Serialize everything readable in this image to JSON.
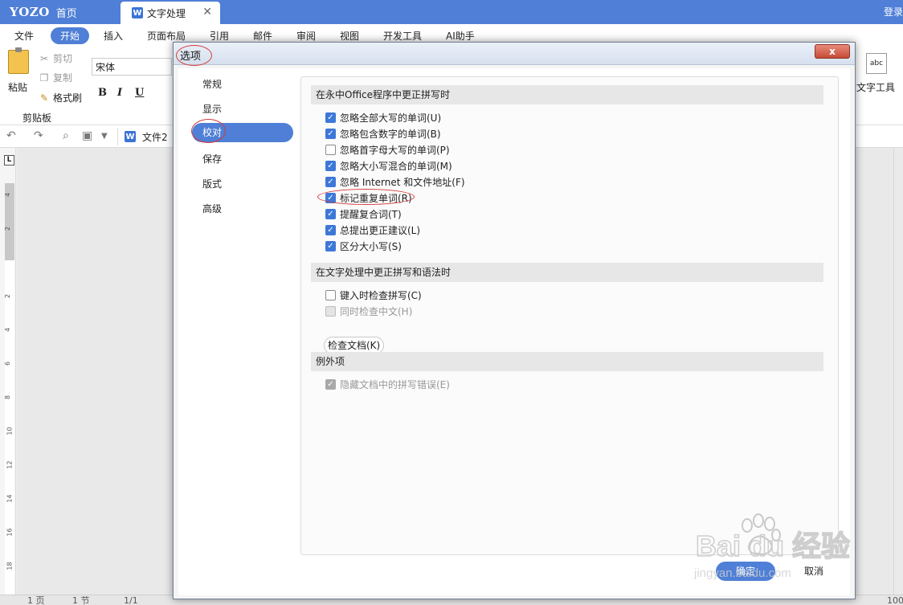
{
  "app": {
    "logo": "YOZO",
    "home_tab": "首页",
    "doc_tab": "文字处理",
    "doc_tab_icon": "W",
    "login": "登录"
  },
  "menu": [
    "文件",
    "开始",
    "插入",
    "页面布局",
    "引用",
    "邮件",
    "审阅",
    "视图",
    "开发工具",
    "AI助手"
  ],
  "ribbon": {
    "paste": "粘贴",
    "cut": "剪切",
    "copy": "复制",
    "format_painter": "格式刷",
    "clipboard_group": "剪贴板",
    "font_name": "宋体",
    "bold": "B",
    "italic": "I",
    "underline": "U",
    "text_tools": "文字工具",
    "text_tools_icon": "abc"
  },
  "quickbar": {
    "document_name": "文件2"
  },
  "ruler": {
    "corner": "L",
    "numbers": [
      "4",
      "2",
      "2",
      "4",
      "6",
      "8",
      "10",
      "12",
      "14",
      "16",
      "18"
    ]
  },
  "dialog": {
    "title": "选项",
    "close": "x",
    "nav": [
      "常规",
      "显示",
      "校对",
      "保存",
      "版式",
      "高级"
    ],
    "active_nav": "校对",
    "sections": [
      {
        "header": "在永中Office程序中更正拼写时",
        "options": [
          {
            "label": "忽略全部大写的单词(U)",
            "checked": true,
            "disabled": false
          },
          {
            "label": "忽略包含数字的单词(B)",
            "checked": true,
            "disabled": false
          },
          {
            "label": "忽略首字母大写的单词(P)",
            "checked": false,
            "disabled": false
          },
          {
            "label": "忽略大小写混合的单词(M)",
            "checked": true,
            "disabled": false
          },
          {
            "label": "忽略 Internet 和文件地址(F)",
            "checked": true,
            "disabled": false
          },
          {
            "label": "标记重复单词(R)",
            "checked": true,
            "disabled": false
          },
          {
            "label": "提醒复合词(T)",
            "checked": true,
            "disabled": false
          },
          {
            "label": "总提出更正建议(L)",
            "checked": true,
            "disabled": false
          },
          {
            "label": "区分大小写(S)",
            "checked": true,
            "disabled": false
          }
        ]
      },
      {
        "header": "在文字处理中更正拼写和语法时",
        "options": [
          {
            "label": "键入时检查拼写(C)",
            "checked": false,
            "disabled": false
          },
          {
            "label": "同时检查中文(H)",
            "checked": false,
            "disabled": true
          }
        ],
        "button": "检查文档(K)"
      },
      {
        "header": "例外项",
        "options": [
          {
            "label": "隐藏文档中的拼写错误(E)",
            "checked": true,
            "disabled": true
          }
        ]
      }
    ],
    "ok": "确定",
    "cancel": "取消"
  },
  "status": [
    "1 页",
    "1 节",
    "1/1",
    "100"
  ],
  "watermark": {
    "brand": "Bai du 经验",
    "url": "jingyan.baidu.com"
  },
  "colors": {
    "accent": "#4f7fd6",
    "checkbox": "#3d78d8",
    "annotation": "#d43b3b"
  }
}
